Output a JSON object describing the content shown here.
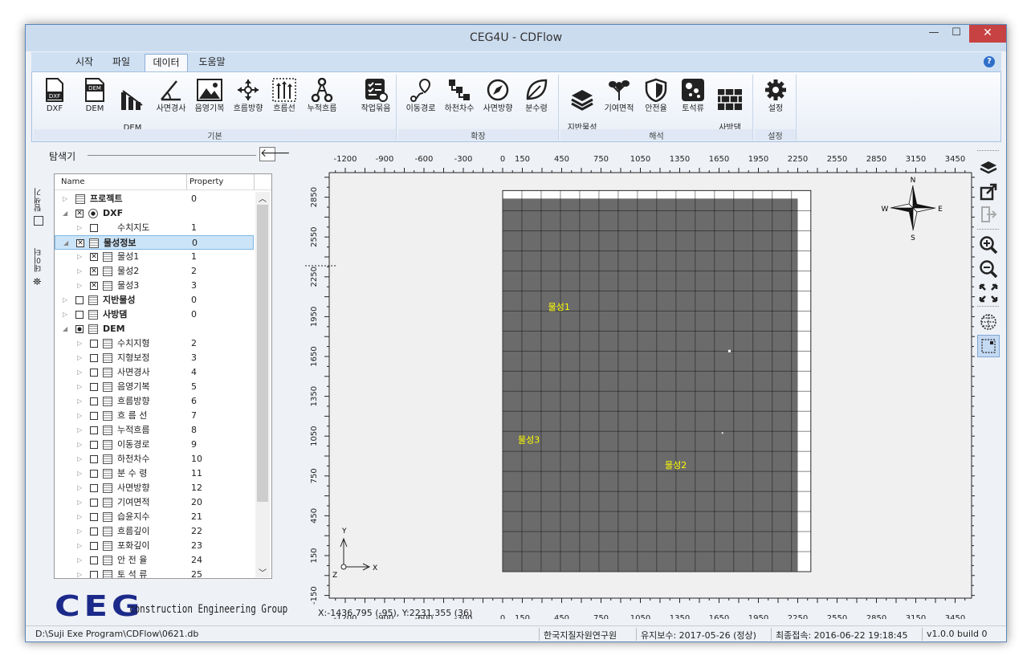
{
  "window": {
    "title": "CEG4U - CDFlow",
    "min": "—",
    "max": "☐",
    "close": "✕"
  },
  "menu": {
    "tabs": [
      "시작",
      "파일",
      "데이터",
      "도움말"
    ],
    "active": "데이터",
    "help": "?"
  },
  "ribbon": {
    "groups": [
      {
        "label": "기본",
        "buttons": [
          "DXF",
          "DEM",
          "DEM\n보정",
          "사면경사",
          "음영기복",
          "흐름방향",
          "흐름선",
          "누적흐름",
          "작업묶음"
        ]
      },
      {
        "label": "확장",
        "buttons": [
          "이동경로",
          "하천차수",
          "사면방향",
          "분수령"
        ]
      },
      {
        "label": "해석",
        "buttons": [
          "지반물성\n보간",
          "기여면적",
          "안전율",
          "토석류",
          "사방댐\n설계"
        ]
      },
      {
        "label": "설정",
        "buttons": [
          "설정"
        ]
      }
    ]
  },
  "explorer": {
    "title": "탐색기",
    "vtabs": [
      "탐색기",
      "데이터"
    ],
    "columns": [
      "Name",
      "Property"
    ],
    "rows": [
      {
        "level": 0,
        "name": "프로젝트",
        "prop": "0",
        "bold": true,
        "check": "none",
        "expand": "▷"
      },
      {
        "level": 0,
        "name": "DXF",
        "prop": "",
        "bold": true,
        "check": "x",
        "expand": "◢"
      },
      {
        "level": 1,
        "name": "수치지도",
        "prop": "1",
        "bold": false,
        "check": "empty",
        "expand": "▷"
      },
      {
        "level": 0,
        "name": "물성정보",
        "prop": "0",
        "bold": true,
        "check": "x",
        "expand": "◢",
        "selected": true
      },
      {
        "level": 1,
        "name": "물성1",
        "prop": "1",
        "bold": false,
        "check": "x",
        "expand": "▷"
      },
      {
        "level": 1,
        "name": "물성2",
        "prop": "2",
        "bold": false,
        "check": "x",
        "expand": "▷"
      },
      {
        "level": 1,
        "name": "물성3",
        "prop": "3",
        "bold": false,
        "check": "x",
        "expand": "▷"
      },
      {
        "level": 0,
        "name": "지반물성",
        "prop": "0",
        "bold": true,
        "check": "empty",
        "expand": "▷"
      },
      {
        "level": 0,
        "name": "사방댐",
        "prop": "0",
        "bold": true,
        "check": "empty",
        "expand": "▷"
      },
      {
        "level": 0,
        "name": "DEM",
        "prop": "",
        "bold": true,
        "check": "partial",
        "expand": "◢"
      },
      {
        "level": 1,
        "name": "수치지형",
        "prop": "2",
        "bold": false,
        "check": "empty",
        "expand": "▷"
      },
      {
        "level": 1,
        "name": "지형보정",
        "prop": "3",
        "bold": false,
        "check": "empty",
        "expand": "▷"
      },
      {
        "level": 1,
        "name": "사면경사",
        "prop": "4",
        "bold": false,
        "check": "empty",
        "expand": "▷"
      },
      {
        "level": 1,
        "name": "음영기복",
        "prop": "5",
        "bold": false,
        "check": "empty",
        "expand": "▷"
      },
      {
        "level": 1,
        "name": "흐름방향",
        "prop": "6",
        "bold": false,
        "check": "empty",
        "expand": "▷"
      },
      {
        "level": 1,
        "name": "흐 름 선",
        "prop": "7",
        "bold": false,
        "check": "empty",
        "expand": "▷"
      },
      {
        "level": 1,
        "name": "누적흐름",
        "prop": "8",
        "bold": false,
        "check": "empty",
        "expand": "▷"
      },
      {
        "level": 1,
        "name": "이동경로",
        "prop": "9",
        "bold": false,
        "check": "empty",
        "expand": "▷"
      },
      {
        "level": 1,
        "name": "하천차수",
        "prop": "10",
        "bold": false,
        "check": "empty",
        "expand": "▷"
      },
      {
        "level": 1,
        "name": "분 수 령",
        "prop": "11",
        "bold": false,
        "check": "empty",
        "expand": "▷"
      },
      {
        "level": 1,
        "name": "사면방향",
        "prop": "12",
        "bold": false,
        "check": "empty",
        "expand": "▷"
      },
      {
        "level": 1,
        "name": "기여면적",
        "prop": "20",
        "bold": false,
        "check": "empty",
        "expand": "▷"
      },
      {
        "level": 1,
        "name": "습윤지수",
        "prop": "21",
        "bold": false,
        "check": "empty",
        "expand": "▷"
      },
      {
        "level": 1,
        "name": "흐름깊이",
        "prop": "22",
        "bold": false,
        "check": "empty",
        "expand": "▷"
      },
      {
        "level": 1,
        "name": "포화깊이",
        "prop": "23",
        "bold": false,
        "check": "empty",
        "expand": "▷"
      },
      {
        "level": 1,
        "name": "안 전 율",
        "prop": "24",
        "bold": false,
        "check": "empty",
        "expand": "▷"
      },
      {
        "level": 1,
        "name": "토 석 류",
        "prop": "25",
        "bold": false,
        "check": "empty",
        "expand": "▷"
      }
    ]
  },
  "logo": {
    "letters": "CEG",
    "text": "construction Engineering Group"
  },
  "map": {
    "x_ticks": [
      "-1200",
      "-900",
      "-600",
      "-300",
      "0",
      "150",
      "450",
      "750",
      "1050",
      "1350",
      "1650",
      "1950",
      "2250",
      "2550",
      "2850",
      "3150",
      "3450"
    ],
    "y_ticks": [
      "2850",
      "2550",
      "2250",
      "1950",
      "1650",
      "1350",
      "1050",
      "750",
      "450",
      "150",
      "-150"
    ],
    "labels": [
      "물성1",
      "물성3",
      "물성2"
    ],
    "compass": {
      "n": "N",
      "s": "S",
      "e": "E",
      "w": "W"
    },
    "axes": {
      "x": "X",
      "y": "Y",
      "z": "Z"
    },
    "coords": "X:-1436.795 (-95), Y:2231.355 (36)",
    "colors": {
      "raster": "#6b6b6b",
      "label": "#ffff00",
      "grid": "#111111"
    }
  },
  "status": {
    "path": "D:\\Suji Exe Program\\CDFlow\\0621.db",
    "org": "한국지질자원연구원",
    "maint": "유지보수: 2017-05-26 (정상)",
    "last": "최종접속: 2016-06-22 19:18:45",
    "version": "v1.0.0 build 0"
  }
}
